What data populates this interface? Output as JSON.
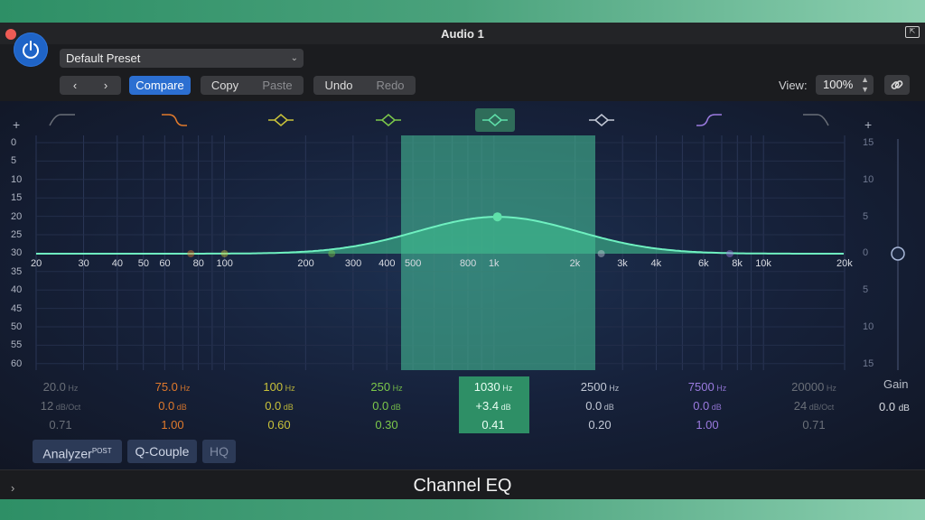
{
  "window": {
    "title": "Audio 1"
  },
  "toolbar": {
    "preset": "Default Preset",
    "compare": "Compare",
    "copy": "Copy",
    "paste": "Paste",
    "undo": "Undo",
    "redo": "Redo",
    "view_label": "View:",
    "view_value": "100%"
  },
  "eq": {
    "left_scale": [
      "0",
      "5",
      "10",
      "15",
      "20",
      "25",
      "30",
      "35",
      "40",
      "45",
      "50",
      "55",
      "60"
    ],
    "right_scale": [
      "15",
      "10",
      "5",
      "0",
      "5",
      "10",
      "15"
    ],
    "freq_labels": [
      "20",
      "30",
      "40",
      "50",
      "60",
      "80",
      "100",
      "200",
      "300",
      "400",
      "500",
      "800",
      "1k",
      "2k",
      "3k",
      "4k",
      "6k",
      "8k",
      "10k",
      "20k"
    ],
    "bands": [
      {
        "freq": "20.0",
        "freq_unit": "Hz",
        "gain": "12",
        "gain_unit": "dB/Oct",
        "q": "0.71",
        "color": "#6a6f78",
        "icon": "low-cut-icon"
      },
      {
        "freq": "75.0",
        "freq_unit": "Hz",
        "gain": "0.0",
        "gain_unit": "dB",
        "q": "1.00",
        "color": "#e07a2c",
        "icon": "low-shelf-icon"
      },
      {
        "freq": "100",
        "freq_unit": "Hz",
        "gain": "0.0",
        "gain_unit": "dB",
        "q": "0.60",
        "color": "#c9c23a",
        "icon": "bell-icon"
      },
      {
        "freq": "250",
        "freq_unit": "Hz",
        "gain": "0.0",
        "gain_unit": "dB",
        "q": "0.30",
        "color": "#7cc84a",
        "icon": "bell-icon"
      },
      {
        "freq": "1030",
        "freq_unit": "Hz",
        "gain": "+3.4",
        "gain_unit": "dB",
        "q": "0.41",
        "color": "#5fe0a9",
        "icon": "bell-icon"
      },
      {
        "freq": "2500",
        "freq_unit": "Hz",
        "gain": "0.0",
        "gain_unit": "dB",
        "q": "0.20",
        "color": "#c3c9d6",
        "icon": "bell-icon"
      },
      {
        "freq": "7500",
        "freq_unit": "Hz",
        "gain": "0.0",
        "gain_unit": "dB",
        "q": "1.00",
        "color": "#9b7be0",
        "icon": "high-shelf-icon"
      },
      {
        "freq": "20000",
        "freq_unit": "Hz",
        "gain": "24",
        "gain_unit": "dB/Oct",
        "q": "0.71",
        "color": "#6a6f78",
        "icon": "high-cut-icon"
      }
    ],
    "gain_label": "Gain",
    "gain_value": "0.0",
    "gain_unit": "dB"
  },
  "footer_buttons": {
    "analyzer": "Analyzer",
    "analyzer_sup": "POST",
    "qcouple": "Q-Couple",
    "hq": "HQ"
  },
  "plugin_name": "Channel EQ"
}
